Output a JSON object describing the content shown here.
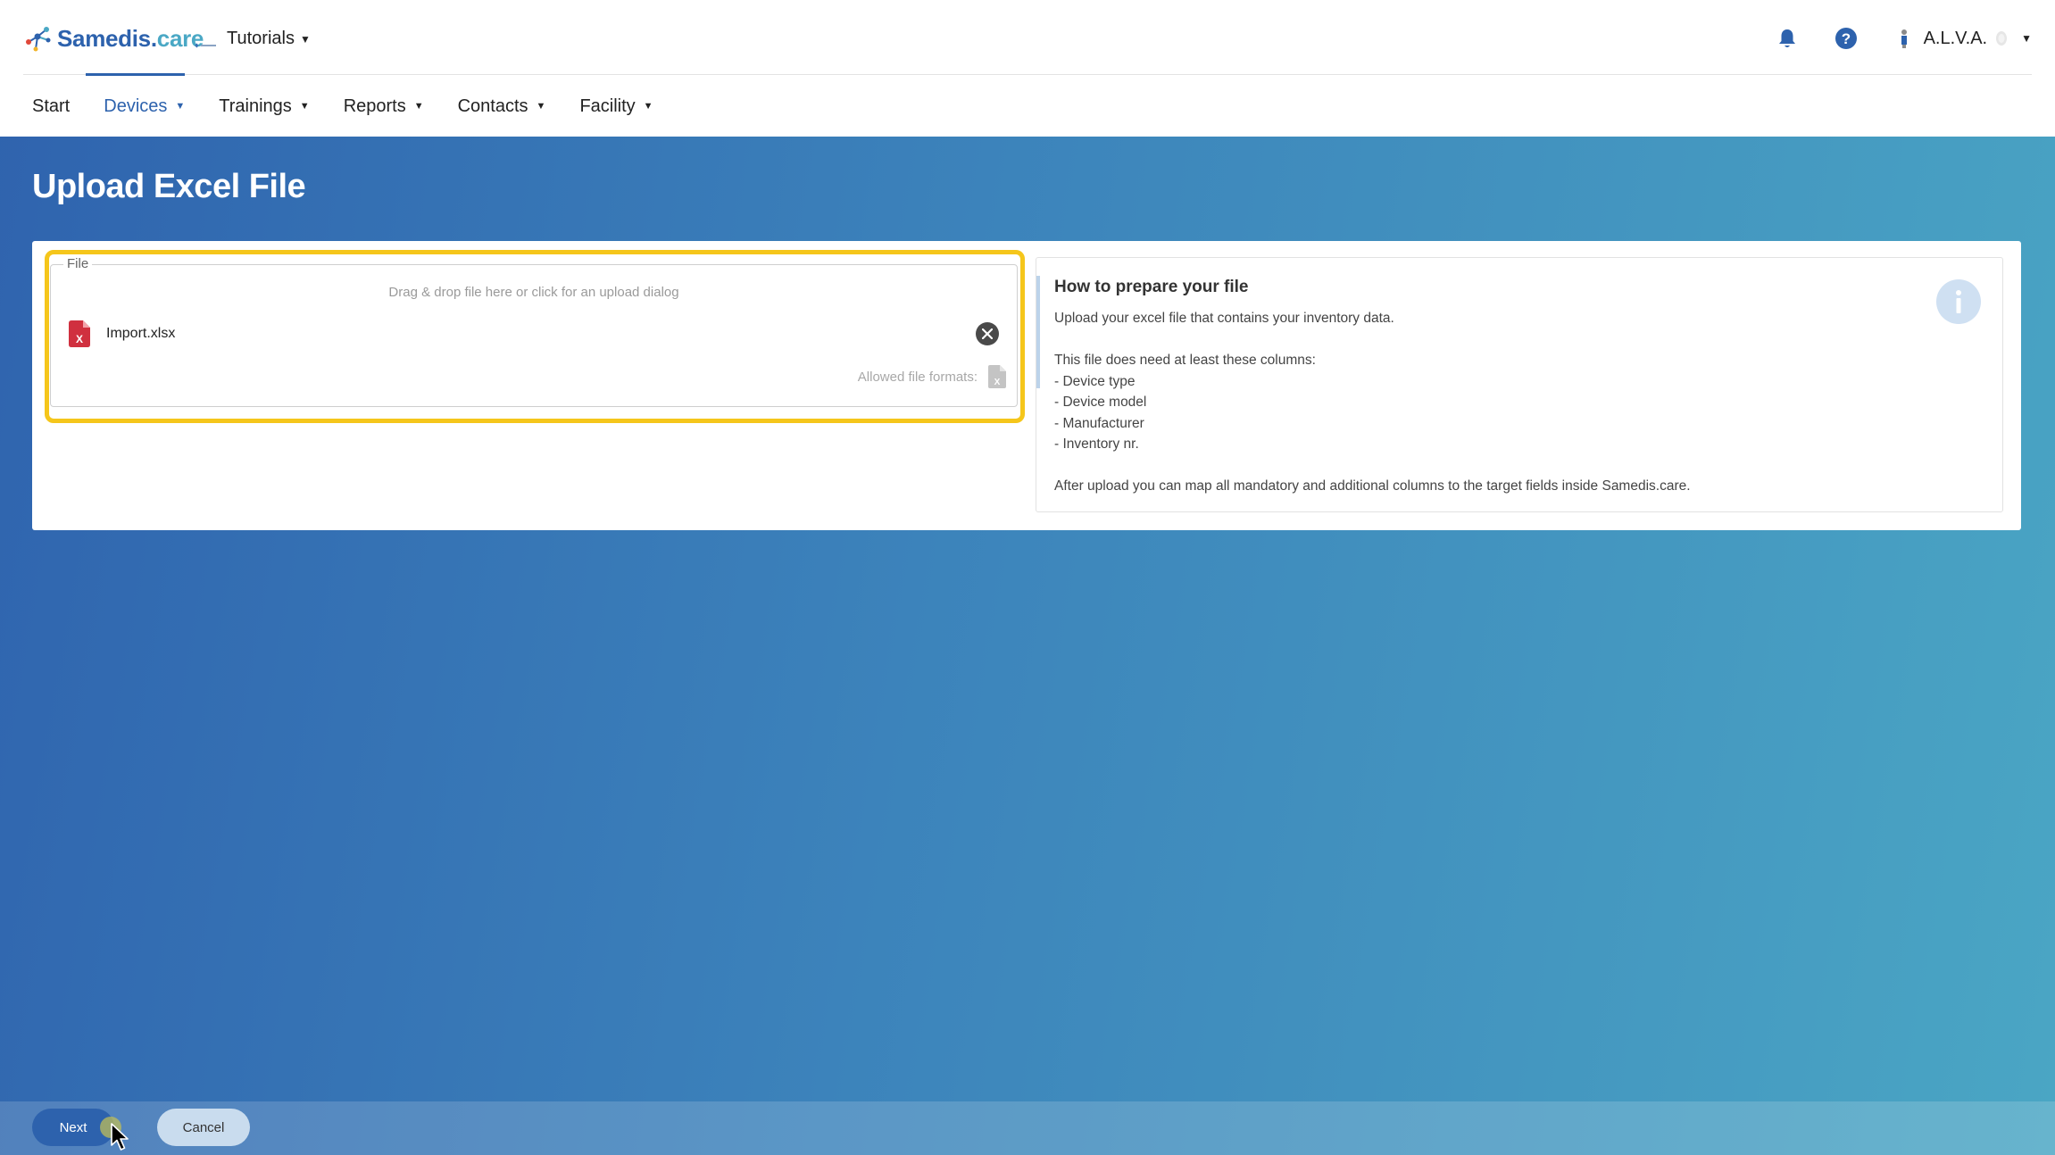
{
  "header": {
    "brand": {
      "part1": "Samedis.",
      "part2": "care"
    },
    "tenant": {
      "name": "Tutorials"
    },
    "user": {
      "name": "A.L.V.A."
    },
    "icons": [
      "bell-icon",
      "help-icon",
      "user-icon"
    ]
  },
  "nav": {
    "items": [
      {
        "label": "Start",
        "dropdown": false,
        "active": false
      },
      {
        "label": "Devices",
        "dropdown": true,
        "active": true
      },
      {
        "label": "Trainings",
        "dropdown": true,
        "active": false
      },
      {
        "label": "Reports",
        "dropdown": true,
        "active": false
      },
      {
        "label": "Contacts",
        "dropdown": true,
        "active": false
      },
      {
        "label": "Facility",
        "dropdown": true,
        "active": false
      }
    ]
  },
  "page": {
    "title": "Upload Excel File"
  },
  "upload": {
    "legend": "File",
    "hint": "Drag & drop file here or click for an upload dialog",
    "file_name": "Import.xlsx",
    "allowed_label": "Allowed file formats:",
    "file_icon": "excel-file-icon"
  },
  "info": {
    "title": "How to prepare your file",
    "lines": [
      "Upload your excel file that contains your inventory data.",
      "",
      "This file does need at least these columns:",
      "- Device type",
      "- Device model",
      "- Manufacturer",
      "- Inventory nr.",
      "",
      "After upload you can map all mandatory and additional columns to the target fields inside Samedis.care."
    ]
  },
  "footer": {
    "next_label": "Next",
    "cancel_label": "Cancel"
  },
  "colors": {
    "primary": "#2d62ad",
    "accent": "#4aa8c5",
    "highlight": "#f5c61b",
    "excel_red": "#d0303f"
  }
}
